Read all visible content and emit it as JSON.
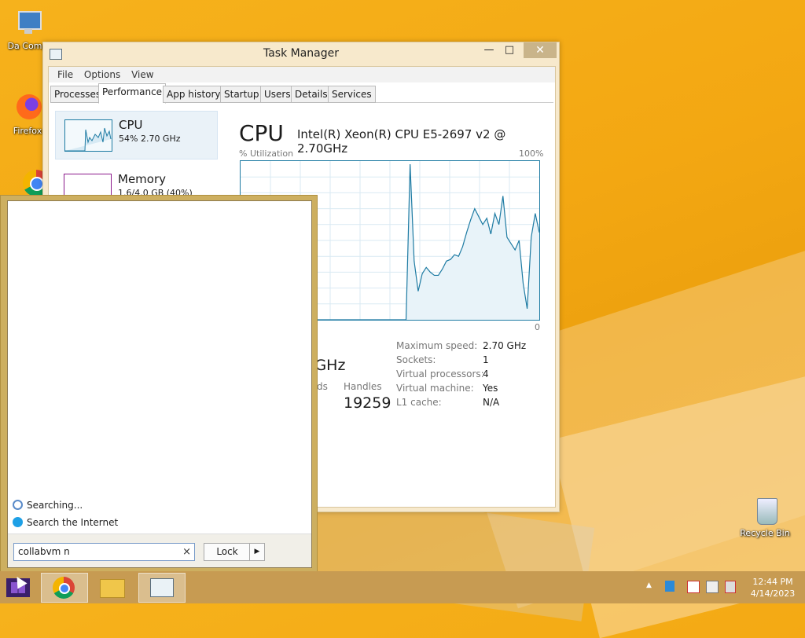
{
  "desktop": {
    "icons": [
      {
        "label": "Da Comp"
      },
      {
        "label": "Firefox"
      },
      {
        "label": "Recycle Bin"
      }
    ]
  },
  "task_manager": {
    "title": "Task Manager",
    "window_buttons": {
      "minimize": "—",
      "maximize": "□",
      "close": "✕"
    },
    "menu": [
      "File",
      "Options",
      "View"
    ],
    "tabs": [
      "Processes",
      "Performance",
      "App history",
      "Startup",
      "Users",
      "Details",
      "Services"
    ],
    "active_tab": "Performance",
    "side": [
      {
        "name": "CPU",
        "sub": "54%  2.70 GHz"
      },
      {
        "name": "Memory",
        "sub": "1.6/4.0 GB (40%)"
      }
    ],
    "cpu": {
      "heading": "CPU",
      "model": "Intel(R) Xeon(R) CPU E5-2697 v2 @ 2.70GHz",
      "util_label": "% Utilization",
      "util_max": "100%",
      "util_min": "0",
      "speed_fragment": ") GHz",
      "threads_fragment": "ds",
      "handles_label": "Handles",
      "handles_value": "19259",
      "specs": [
        {
          "k": "Maximum speed:",
          "v": "2.70 GHz"
        },
        {
          "k": "Sockets:",
          "v": "1"
        },
        {
          "k": "Virtual processors:",
          "v": "4"
        },
        {
          "k": "Virtual machine:",
          "v": "Yes"
        },
        {
          "k": "L1 cache:",
          "v": "N/A"
        }
      ],
      "history": [
        0,
        0,
        0,
        0,
        0,
        0,
        0,
        0,
        0,
        0,
        0,
        0,
        0,
        0,
        0,
        0,
        0,
        0,
        0,
        0,
        0,
        0,
        0,
        0,
        0,
        0,
        0,
        0,
        0,
        0,
        0,
        0,
        0,
        0,
        0,
        0,
        0,
        0,
        0,
        0,
        0,
        0,
        98,
        37,
        18,
        29,
        33,
        30,
        28,
        28,
        32,
        37,
        38,
        41,
        40,
        46,
        55,
        63,
        70,
        65,
        60,
        64,
        54,
        67,
        60,
        78,
        52,
        48,
        44,
        50,
        23,
        7,
        52,
        67,
        55
      ]
    },
    "accent": "#1e7ba3"
  },
  "start_panel": {
    "results": [
      {
        "icon": "search-progress-icon",
        "label": "Searching..."
      },
      {
        "icon": "internet-explorer-icon",
        "label": "Search the Internet"
      }
    ],
    "search_value": "collabvm n",
    "clear_glyph": "×",
    "lock_label": "Lock",
    "lock_arrow": "▶"
  },
  "taskbar": {
    "apps": [
      "chrome-icon",
      "file-explorer-icon",
      "task-manager-icon"
    ],
    "tray_expand": "▲",
    "time": "12:44 PM",
    "date": "4/14/2023"
  }
}
